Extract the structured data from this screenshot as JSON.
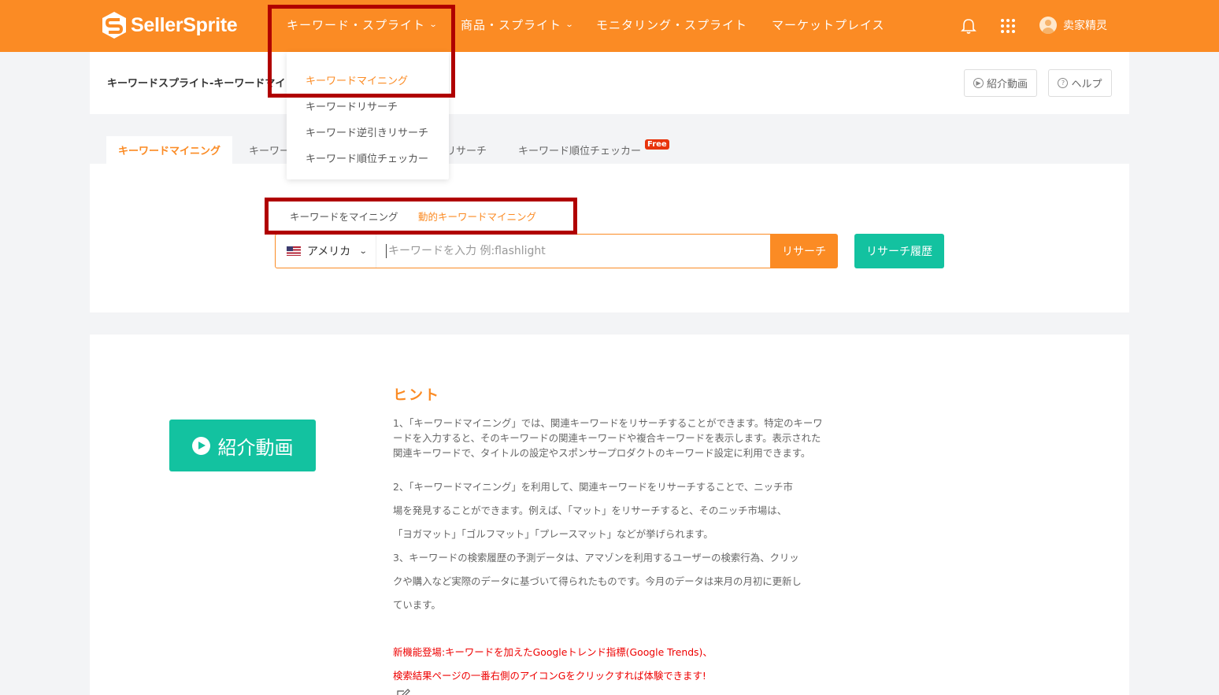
{
  "brand": {
    "name": "SellerSprite",
    "accent": "#fb8b24",
    "teal": "#13c2a0",
    "badge_red": "#e8340c",
    "annotation_red": "#b00000"
  },
  "nav": {
    "items": [
      {
        "label": "キーワード・スプライト",
        "has_dropdown": true
      },
      {
        "label": "商品・スプライト",
        "has_dropdown": true
      },
      {
        "label": "モニタリング・スプライト",
        "has_dropdown": false
      },
      {
        "label": "マーケットプレイス",
        "has_dropdown": false
      }
    ],
    "icons": [
      "bell-icon",
      "apps-grid-icon"
    ],
    "user_name": "卖家精灵"
  },
  "dropdown": {
    "items": [
      {
        "label": "キーワードマイニング",
        "active": true
      },
      {
        "label": "キーワードリサーチ",
        "active": false
      },
      {
        "label": "キーワード逆引きリサーチ",
        "active": false
      },
      {
        "label": "キーワード順位チェッカー",
        "active": false
      }
    ]
  },
  "header": {
    "breadcrumb": "キーワードスプライト-キーワードマイ",
    "intro_video_label": "紹介動画",
    "help_label": "ヘルプ"
  },
  "tabs": [
    {
      "label": "キーワードマイニング",
      "active": true
    },
    {
      "label": "キーワー",
      "active": false
    },
    {
      "label": "リサーチ",
      "active": false
    },
    {
      "label": "キーワード順位チェッカー",
      "active": false,
      "badge": "Free"
    }
  ],
  "search": {
    "mode_tabs": [
      {
        "label": "キーワードをマイニング",
        "active": false
      },
      {
        "label": "動的キーワードマイニング",
        "active": true
      }
    ],
    "country": "アメリカ",
    "placeholder": "キーワードを入力 例:flashlight",
    "value": "",
    "search_button": "リサーチ",
    "history_button": "リサーチ履歴"
  },
  "content": {
    "video_button": "紹介動画",
    "hint_title": "ヒント",
    "hint_1": "1、「キーワードマイニング」では、関連キーワードをリサーチすることができます。特定のキーワードを入力すると、そのキーワードの関連キーワードや複合キーワードを表示します。表示された関連キーワードで、タイトルの設定やスポンサープロダクトのキーワード設定に利用できます。",
    "hint_2_line1": "2、「キーワードマイニング」を利用して、関連キーワードをリサーチすることで、ニッチ市",
    "hint_2_line2": "場を発見することができます。例えば、「マット」をリサーチすると、そのニッチ市場は、",
    "hint_2_line3": "「ヨガマット」「ゴルフマット」「プレースマット」などが挙げられます。",
    "hint_3_line1": "3、キーワードの検索履歴の予測データは、アマゾンを利用するユーザーの検索行為、クリッ",
    "hint_3_line2": "クや購入など実際のデータに基づいて得られたものです。今月のデータは来月の月初に更新し",
    "hint_3_line3": "ています。",
    "new_feature_line1": "新機能登場:キーワードを加えたGoogleトレンド指標(Google Trends)、",
    "new_feature_line2": "検索結果ページの一番右側のアイコンGをクリックすれば体験できます!"
  }
}
